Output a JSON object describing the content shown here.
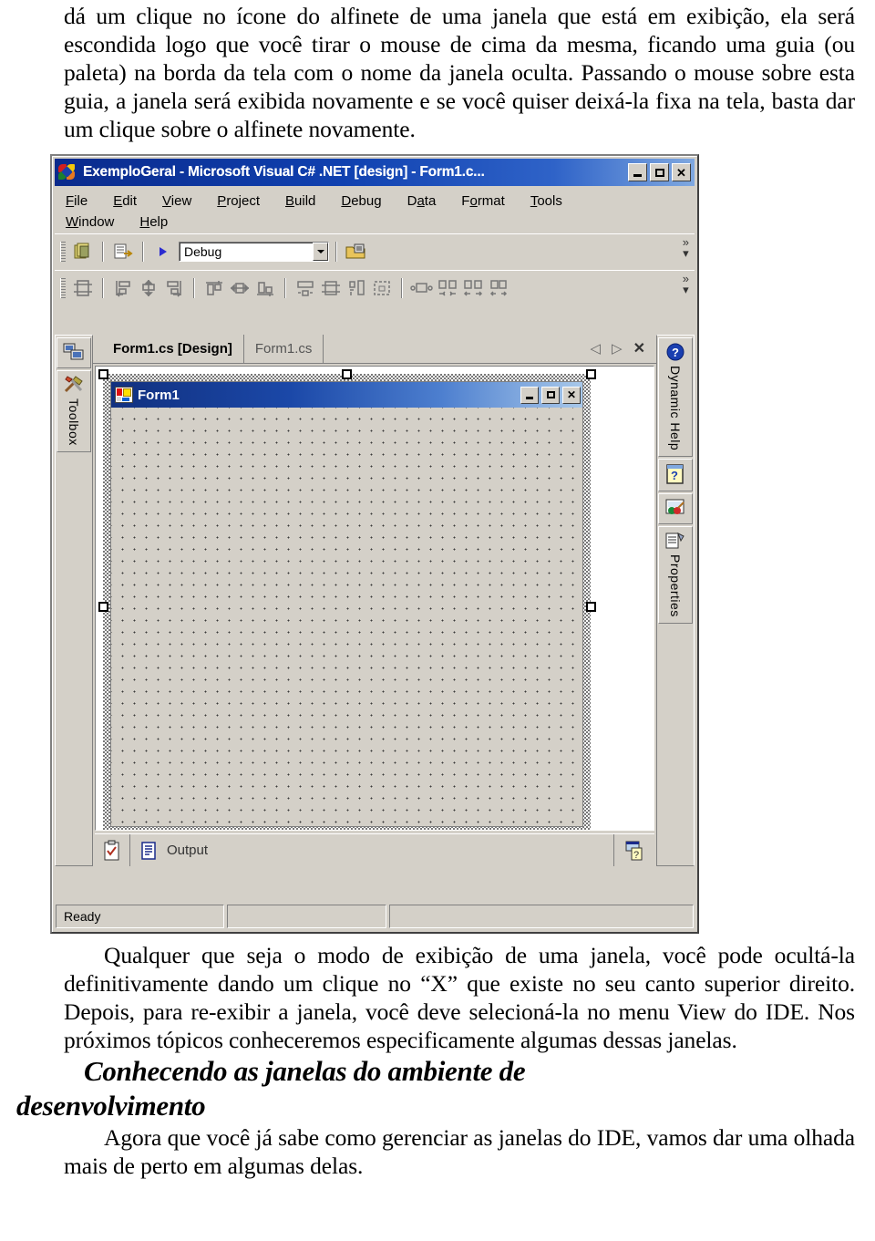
{
  "document": {
    "paragraph_1": "dá um clique no ícone do alfinete de uma janela que está em exibição, ela será escondida logo que você tirar o mouse de cima da mesma, ficando uma guia (ou paleta) na borda da tela com o nome da janela oculta. Passando o mouse sobre esta guia, a janela será exibida novamente e se você quiser deixá-la fixa na tela, basta dar um clique sobre o alfinete novamente.",
    "paragraph_2": "Qualquer que seja o modo de exibição de uma janela, você pode ocultá-la definitivamente dando um clique no “X” que existe no seu canto superior direito. Depois, para re-exibir a janela, você deve selecioná-la no menu View do IDE. Nos próximos tópicos conheceremos especificamente algumas dessas janelas.",
    "heading_line1": "Conhecendo as janelas do ambiente de",
    "heading_line2": "desenvolvimento",
    "paragraph_3": "Agora que você já sabe como gerenciar as janelas do IDE, vamos dar uma olhada mais de perto em algumas delas."
  },
  "ide": {
    "titlebar": {
      "title": "ExemploGeral - Microsoft Visual C# .NET [design] - Form1.c...",
      "app_icon": "visual-studio-icon",
      "minimize": "_",
      "maximize": "□",
      "close": "X"
    },
    "menus_row1": [
      "File",
      "Edit",
      "View",
      "Project",
      "Build",
      "Debug",
      "Data",
      "Format",
      "Tools"
    ],
    "menus_row2": [
      "Window",
      "Help"
    ],
    "toolbar_standard": {
      "icons": [
        "add-new-item-icon",
        "properties-window-icon",
        "start-debug-icon",
        "solution-configuration-icon"
      ],
      "configuration_value": "Debug",
      "overflow": "»"
    },
    "toolbar_layout": {
      "icons": [
        "bring-to-front-icon",
        "align-lefts-icon",
        "align-centers-icon",
        "align-rights-icon",
        "align-tops-icon",
        "align-middles-icon",
        "align-bottoms-icon",
        "make-same-width-icon",
        "make-same-size-icon",
        "make-same-height-icon",
        "size-to-grid-icon",
        "make-horizontal-spacing-equal-icon",
        "decrease-horizontal-spacing-icon",
        "increase-horizontal-spacing-icon",
        "remove-horizontal-spacing-icon"
      ],
      "overflow": "»"
    },
    "left_sidebar": {
      "tabs": [
        {
          "label": "",
          "icon": "server-explorer-icon"
        },
        {
          "label": "Toolbox",
          "icon": "toolbox-hammer-icon"
        }
      ]
    },
    "right_sidebar": {
      "tabs": [
        {
          "label": "Dynamic Help",
          "icon": "dynamic-help-question-icon"
        },
        {
          "label": "",
          "icon": "help-question-icon"
        },
        {
          "label": "",
          "icon": "palette-icon"
        },
        {
          "label": "Properties",
          "icon": "properties-icon"
        }
      ]
    },
    "document_tabs": [
      {
        "label": "Form1.cs [Design]",
        "active": true
      },
      {
        "label": "Form1.cs",
        "active": false
      }
    ],
    "tab_nav": {
      "prev": "◁",
      "next": "▷",
      "close": "✕"
    },
    "designer": {
      "form_title": "Form1",
      "form_icon": "form-designer-icon",
      "form_minimize": "_",
      "form_maximize": "□",
      "form_close": "X"
    },
    "output_pane": {
      "tabs": [
        "task-list-icon",
        "output-icon"
      ],
      "label": "Output",
      "right_icon": "dynamic-help-tab-icon"
    },
    "status_bar": {
      "cell1": "Ready",
      "cell2": "",
      "cell3": ""
    }
  },
  "colors": {
    "title_gradient_start": "#0a2a8c",
    "title_gradient_end": "#7fa8e0",
    "chrome": "#d4d0c8",
    "border": "#808080"
  }
}
